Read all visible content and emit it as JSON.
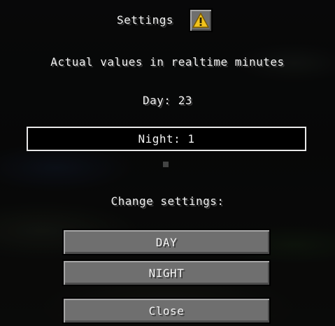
{
  "title": "Settings",
  "info_text": "Actual values in realtime minutes",
  "day_value": "Day: 23",
  "night_value": "Night: 1",
  "change_label": "Change settings:",
  "buttons": {
    "day": "DAY",
    "night": "NIGHT",
    "close": "Close"
  },
  "icons": {
    "warning": "warning-icon"
  },
  "colors": {
    "button_face": "#6f6f6f",
    "warning_yellow": "#f2c31b",
    "text": "#f2f2f2"
  }
}
